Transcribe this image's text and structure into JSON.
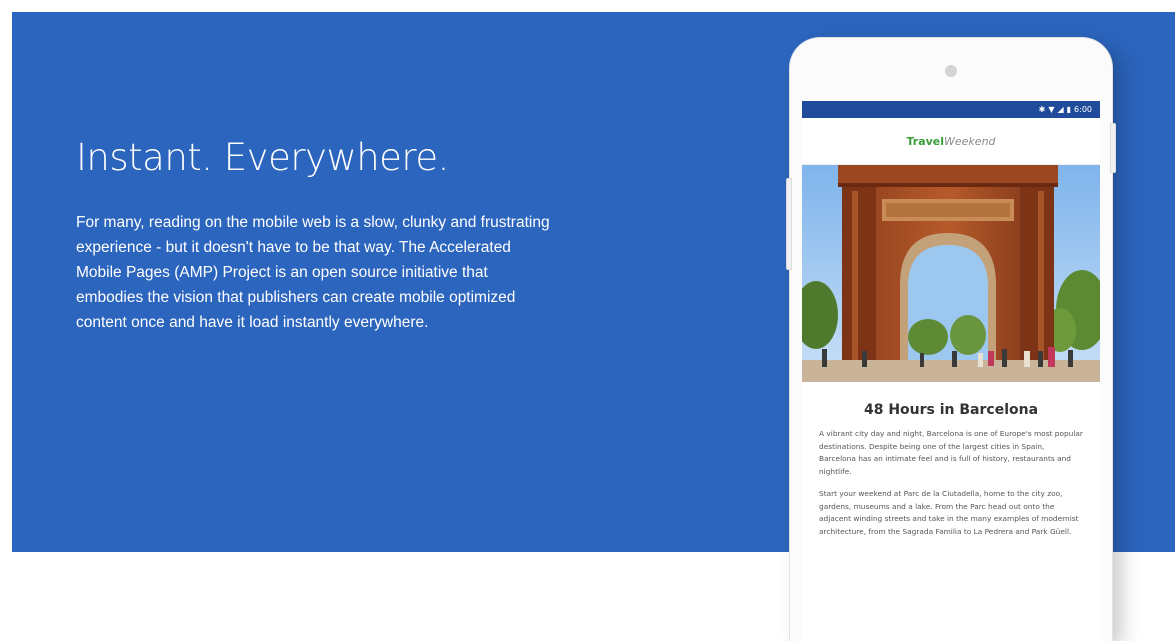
{
  "hero": {
    "title": "Instant. Everywhere.",
    "description": "For many, reading on the mobile web is a slow, clunky and frustrating experience - but it doesn't have to be that way. The Accelerated Mobile Pages (AMP) Project is an open source initiative that embodies the vision that publishers can create mobile optimized content once and have it load instantly everywhere.",
    "background_color": "#2c65bd"
  },
  "phone": {
    "status_bar": {
      "time": "6:00",
      "icons": [
        "bluetooth-icon",
        "wifi-icon",
        "signal-icon",
        "battery-icon"
      ],
      "color": "#1f4b9a"
    },
    "logo": {
      "part1": "Travel",
      "part2": "Weekend"
    },
    "article": {
      "image": "arc-de-triomf-photo",
      "title": "48 Hours in Barcelona",
      "paragraphs": [
        "A vibrant city day and night, Barcelona is one of Europe's most popular destinations. Despite being one of the largest cities in Spain, Barcelona has an intimate feel and is full of history, restaurants and nightlife.",
        "Start your weekend at Parc de la Ciutadella, home to the city zoo, gardens, museums and a lake. From the Parc head out onto the adjacent winding streets and take in the many examples of modernist architecture, from the Sagrada Familia to La Pedrera and Park Güell."
      ]
    }
  }
}
